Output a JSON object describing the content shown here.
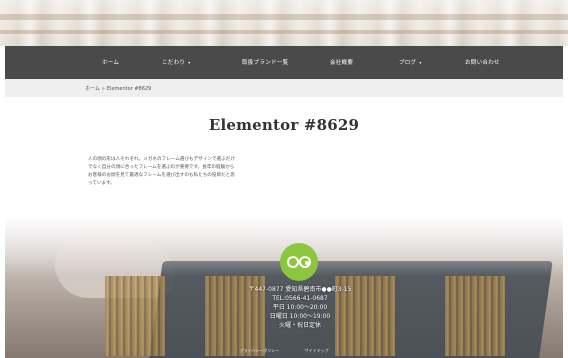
{
  "nav": {
    "items": [
      {
        "label": "ホーム",
        "has_dropdown": false
      },
      {
        "label": "こだわり",
        "has_dropdown": true
      },
      {
        "label": "取扱ブランド一覧",
        "has_dropdown": false
      },
      {
        "label": "会社概要",
        "has_dropdown": false
      },
      {
        "label": "ブログ",
        "has_dropdown": true
      },
      {
        "label": "お問い合わせ",
        "has_dropdown": false
      }
    ],
    "caret": "▾"
  },
  "breadcrumb": {
    "home": "ホーム",
    "separator": "»",
    "current": "Elementor #8629"
  },
  "page": {
    "title": "Elementor #8629",
    "intro": "人の顔の形は人それぞれ。メガネのフレーム選びもデザインで選ぶだけでなく自分の顔に合ったフレームを選ぶのが重要です。長年の経験からお客様のお顔を見て最適なフレームを選び出すのも私たちの役目だと思っています。"
  },
  "footer": {
    "address": "〒447-0877 愛知県碧南市●●町3-15",
    "tel": "TEL:0566-41-0687",
    "hours_weekday": "平日 10:00〜20:00",
    "hours_sunday": "日曜日 10:00〜19:00",
    "closed": "火曜・祝日定休",
    "link_privacy": "プライバシーポリシー",
    "link_sitemap": "サイトマップ"
  },
  "colors": {
    "nav_bg": "#4a4a4a",
    "accent_green": "#8cc63f",
    "breadcrumb_bg": "#efefef"
  },
  "icons": {
    "logo": "glasses-icon"
  }
}
